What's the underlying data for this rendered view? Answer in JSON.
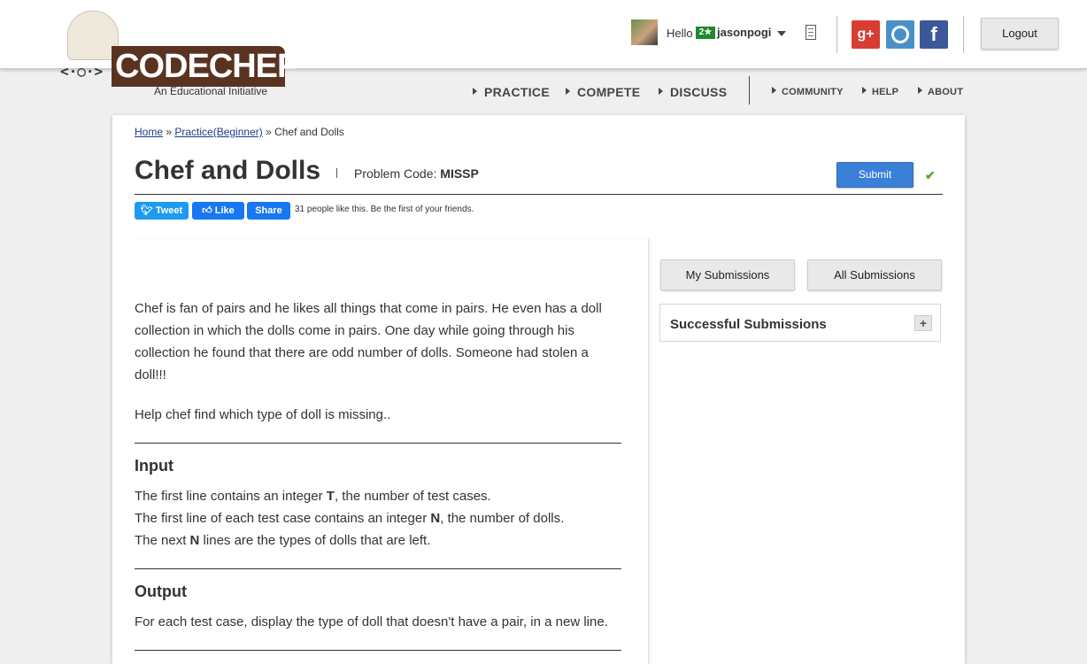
{
  "logo": {
    "wordmark": "CODECHEF",
    "tagline": "An Educational Initiative",
    "face": "<·○·>"
  },
  "user": {
    "greeting": "Hello",
    "rating_badge": "2★",
    "username": "jasonpogi"
  },
  "header": {
    "logout_label": "Logout",
    "social": {
      "google_plus": "g+",
      "facebook": "f"
    }
  },
  "nav": {
    "main": [
      "PRACTICE",
      "COMPETE",
      "DISCUSS"
    ],
    "secondary": [
      "COMMUNITY",
      "HELP",
      "ABOUT"
    ]
  },
  "breadcrumb": {
    "home": "Home",
    "sep1": " » ",
    "practice": "Practice(Beginner)",
    "sep2": " » ",
    "current": "Chef and Dolls"
  },
  "problem": {
    "title": "Chef and Dolls",
    "code_label": "Problem Code: ",
    "code": "MISSP",
    "submit_label": "Submit",
    "solved_mark": "✔",
    "paragraph1": "Chef is fan of pairs and he likes all things that come in pairs. He even has a doll collection in which the dolls come in pairs. One day while going through his collection he found that there are odd number of dolls. Someone had stolen a doll!!!",
    "paragraph2": "Help chef find which type of doll is missing..",
    "input_heading": "Input",
    "input_lines": [
      {
        "pre": "The first line contains an integer ",
        "bold": "T",
        "post": ", the number of test cases."
      },
      {
        "pre": "The first line of each test case contains an integer ",
        "bold": "N",
        "post": ", the number of dolls."
      },
      {
        "pre": "The next ",
        "bold": "N",
        "post": " lines are the types of dolls that are left."
      }
    ],
    "output_heading": "Output",
    "output_line": "For each test case, display the type of doll that doesn't have a pair, in a new line."
  },
  "social_share": {
    "tweet": "Tweet",
    "like": "Like",
    "share": "Share",
    "likes_text": "31 people like this. Be the first of your friends."
  },
  "sidebar": {
    "my_submissions": "My Submissions",
    "all_submissions": "All Submissions",
    "successful_submissions": "Successful Submissions",
    "expand": "+"
  }
}
